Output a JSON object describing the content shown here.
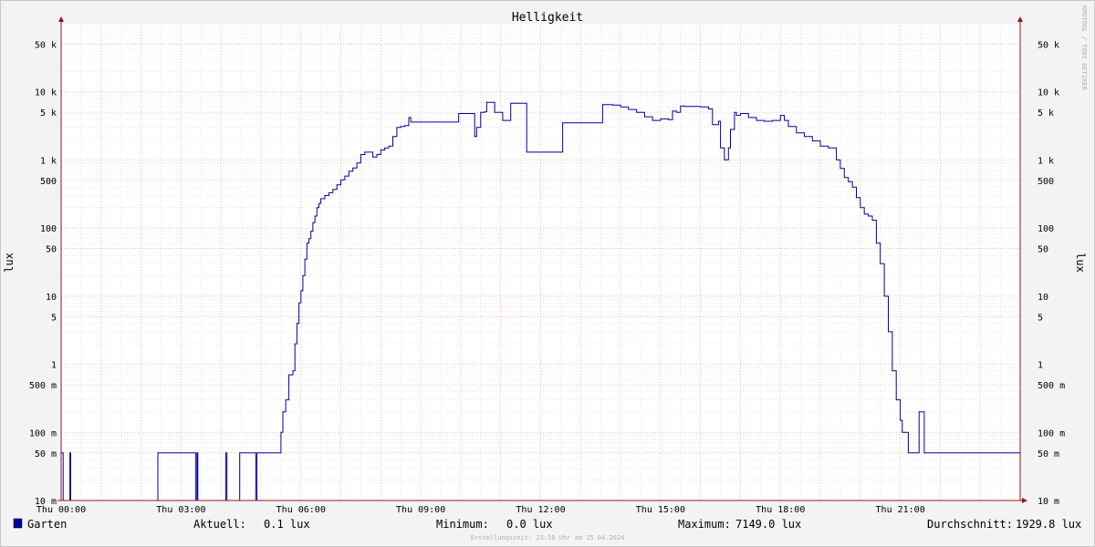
{
  "chart_data": {
    "type": "line",
    "title": "Helligkeit",
    "ylabel": "lux",
    "y_scale": "log",
    "ylim": [
      0.01,
      100000
    ],
    "xlim_hours": [
      0,
      24
    ],
    "x_ticks": [
      {
        "h": 0,
        "label": "Thu 00:00"
      },
      {
        "h": 3,
        "label": "Thu 03:00"
      },
      {
        "h": 6,
        "label": "Thu 06:00"
      },
      {
        "h": 9,
        "label": "Thu 09:00"
      },
      {
        "h": 12,
        "label": "Thu 12:00"
      },
      {
        "h": 15,
        "label": "Thu 15:00"
      },
      {
        "h": 18,
        "label": "Thu 18:00"
      },
      {
        "h": 21,
        "label": "Thu 21:00"
      }
    ],
    "y_ticks": [
      {
        "v": 50000,
        "label": "50 k"
      },
      {
        "v": 10000,
        "label": "10 k"
      },
      {
        "v": 5000,
        "label": "5 k"
      },
      {
        "v": 1000,
        "label": "1 k"
      },
      {
        "v": 500,
        "label": "500"
      },
      {
        "v": 100,
        "label": "100"
      },
      {
        "v": 50,
        "label": "50"
      },
      {
        "v": 10,
        "label": "10"
      },
      {
        "v": 5,
        "label": "5"
      },
      {
        "v": 1,
        "label": "1"
      },
      {
        "v": 0.5,
        "label": "500 m"
      },
      {
        "v": 0.1,
        "label": "100 m"
      },
      {
        "v": 0.05,
        "label": "50 m"
      },
      {
        "v": 0.01,
        "label": "10 m"
      }
    ],
    "grid": true,
    "legend_position": "bottom-left",
    "series": [
      {
        "name": "Garten",
        "color": "#0000a0",
        "points": [
          [
            0.0,
            0.05
          ],
          [
            0.05,
            0.01
          ],
          [
            0.2,
            0.01
          ],
          [
            0.22,
            0.05
          ],
          [
            0.24,
            0.01
          ],
          [
            2.4,
            0.01
          ],
          [
            2.42,
            0.05
          ],
          [
            3.35,
            0.05
          ],
          [
            3.37,
            0.01
          ],
          [
            3.4,
            0.05
          ],
          [
            3.42,
            0.01
          ],
          [
            4.1,
            0.01
          ],
          [
            4.12,
            0.05
          ],
          [
            4.15,
            0.01
          ],
          [
            4.45,
            0.01
          ],
          [
            4.47,
            0.05
          ],
          [
            4.85,
            0.05
          ],
          [
            4.87,
            0.01
          ],
          [
            4.9,
            0.05
          ],
          [
            5.35,
            0.05
          ],
          [
            5.5,
            0.1
          ],
          [
            5.55,
            0.2
          ],
          [
            5.62,
            0.3
          ],
          [
            5.7,
            0.7
          ],
          [
            5.8,
            0.8
          ],
          [
            5.85,
            2
          ],
          [
            5.9,
            4
          ],
          [
            5.95,
            8
          ],
          [
            6.0,
            12
          ],
          [
            6.05,
            20
          ],
          [
            6.1,
            35
          ],
          [
            6.15,
            60
          ],
          [
            6.2,
            70
          ],
          [
            6.25,
            90
          ],
          [
            6.3,
            120
          ],
          [
            6.35,
            150
          ],
          [
            6.4,
            200
          ],
          [
            6.45,
            230
          ],
          [
            6.5,
            270
          ],
          [
            6.6,
            300
          ],
          [
            6.7,
            330
          ],
          [
            6.8,
            370
          ],
          [
            6.9,
            430
          ],
          [
            7.0,
            510
          ],
          [
            7.1,
            580
          ],
          [
            7.2,
            680
          ],
          [
            7.3,
            760
          ],
          [
            7.4,
            900
          ],
          [
            7.5,
            1200
          ],
          [
            7.6,
            1300
          ],
          [
            7.7,
            1300
          ],
          [
            7.8,
            1100
          ],
          [
            7.9,
            1200
          ],
          [
            8.0,
            1400
          ],
          [
            8.1,
            1500
          ],
          [
            8.2,
            1600
          ],
          [
            8.3,
            2200
          ],
          [
            8.4,
            3000
          ],
          [
            8.5,
            3100
          ],
          [
            8.6,
            3200
          ],
          [
            8.7,
            4200
          ],
          [
            8.75,
            3600
          ],
          [
            9.0,
            3600
          ],
          [
            9.5,
            3600
          ],
          [
            9.9,
            3600
          ],
          [
            9.95,
            4800
          ],
          [
            10.3,
            4800
          ],
          [
            10.35,
            2200
          ],
          [
            10.4,
            3000
          ],
          [
            10.5,
            5000
          ],
          [
            10.6,
            5100
          ],
          [
            10.65,
            7000
          ],
          [
            10.8,
            7000
          ],
          [
            10.85,
            5000
          ],
          [
            11.0,
            5000
          ],
          [
            11.05,
            3800
          ],
          [
            11.2,
            3800
          ],
          [
            11.25,
            6800
          ],
          [
            11.6,
            6800
          ],
          [
            11.65,
            1300
          ],
          [
            12.5,
            1300
          ],
          [
            12.55,
            3500
          ],
          [
            13.3,
            3500
          ],
          [
            13.5,
            3500
          ],
          [
            13.55,
            6500
          ],
          [
            13.8,
            6400
          ],
          [
            14.0,
            6000
          ],
          [
            14.2,
            5500
          ],
          [
            14.4,
            5000
          ],
          [
            14.6,
            4300
          ],
          [
            14.8,
            3800
          ],
          [
            15.0,
            4000
          ],
          [
            15.2,
            3900
          ],
          [
            15.3,
            5200
          ],
          [
            15.4,
            5000
          ],
          [
            15.5,
            6200
          ],
          [
            15.6,
            6100
          ],
          [
            16.0,
            6000
          ],
          [
            16.2,
            5600
          ],
          [
            16.3,
            3300
          ],
          [
            16.45,
            3700
          ],
          [
            16.5,
            1500
          ],
          [
            16.6,
            1000
          ],
          [
            16.7,
            1500
          ],
          [
            16.75,
            2800
          ],
          [
            16.85,
            5000
          ],
          [
            16.9,
            4500
          ],
          [
            17.0,
            4800
          ],
          [
            17.2,
            4200
          ],
          [
            17.4,
            3800
          ],
          [
            17.6,
            3700
          ],
          [
            17.8,
            3800
          ],
          [
            18.0,
            4500
          ],
          [
            18.1,
            3800
          ],
          [
            18.2,
            3100
          ],
          [
            18.4,
            2500
          ],
          [
            18.6,
            2200
          ],
          [
            18.8,
            1900
          ],
          [
            19.0,
            1600
          ],
          [
            19.2,
            1500
          ],
          [
            19.4,
            1000
          ],
          [
            19.5,
            750
          ],
          [
            19.6,
            550
          ],
          [
            19.7,
            480
          ],
          [
            19.8,
            400
          ],
          [
            19.9,
            280
          ],
          [
            20.0,
            200
          ],
          [
            20.1,
            160
          ],
          [
            20.2,
            150
          ],
          [
            20.3,
            130
          ],
          [
            20.4,
            60
          ],
          [
            20.5,
            30
          ],
          [
            20.6,
            10
          ],
          [
            20.7,
            3
          ],
          [
            20.8,
            0.8
          ],
          [
            20.9,
            0.3
          ],
          [
            21.0,
            0.15
          ],
          [
            21.05,
            0.1
          ],
          [
            21.2,
            0.05
          ],
          [
            21.45,
            0.05
          ],
          [
            21.47,
            0.2
          ],
          [
            21.58,
            0.2
          ],
          [
            21.6,
            0.05
          ],
          [
            24.0,
            0.05
          ]
        ]
      }
    ],
    "stats": {
      "current_label": "Aktuell:",
      "current_value": "0.1 lux",
      "min_label": "Minimum:",
      "min_value": "0.0 lux",
      "max_label": "Maximum:",
      "max_value": "7149.0 lux",
      "avg_label": "Durchschnitt:",
      "avg_value": "1929.8 lux"
    },
    "footer": "Erstellungszeit: 23:58 Uhr am 25.04.2024",
    "watermark": "RRDTOOL / TOBI OETIKER"
  }
}
